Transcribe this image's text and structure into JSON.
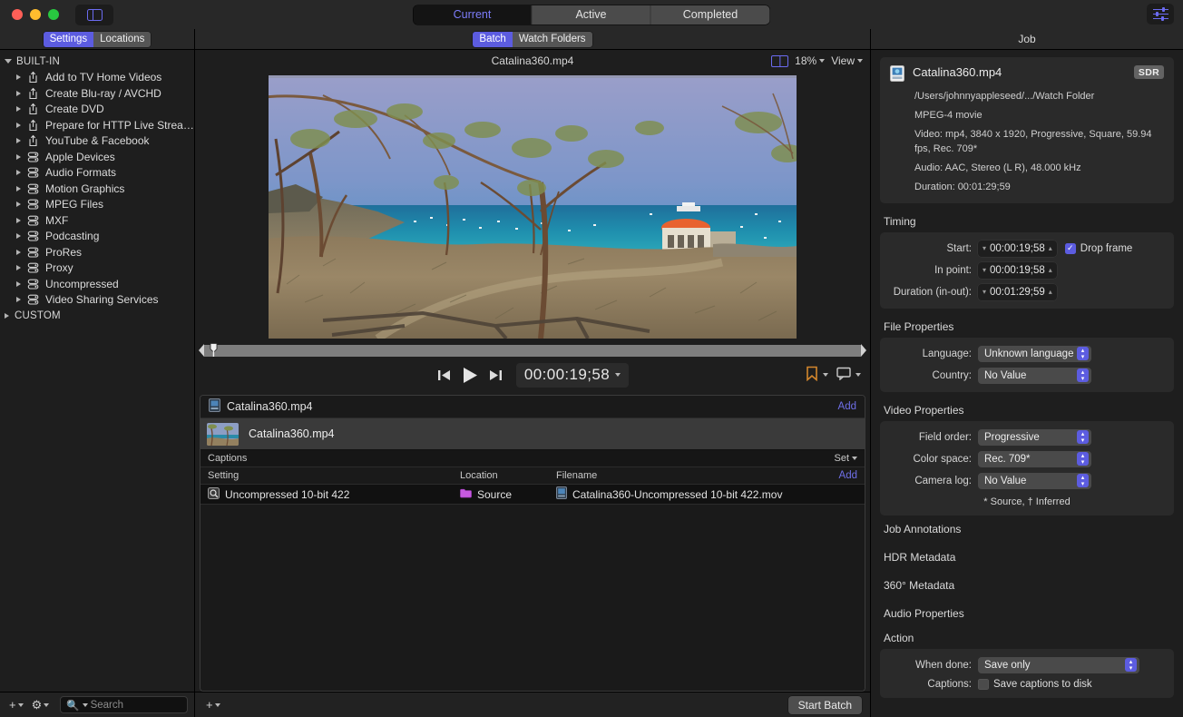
{
  "titlebar": {
    "sidebar_toggle_icon": "sidebar-icon",
    "segments": [
      {
        "label": "Current",
        "selected": true
      },
      {
        "label": "Active",
        "selected": false
      },
      {
        "label": "Completed",
        "selected": false
      }
    ],
    "inspector_toggle_icon": "sliders-icon"
  },
  "sidebar": {
    "tabs": [
      {
        "label": "Settings",
        "selected": true
      },
      {
        "label": "Locations",
        "selected": false
      }
    ],
    "groups": [
      {
        "label": "BUILT-IN",
        "expanded": true,
        "items": [
          {
            "label": "Add to TV Home Videos",
            "icon": "share-icon"
          },
          {
            "label": "Create Blu-ray / AVCHD",
            "icon": "share-icon"
          },
          {
            "label": "Create DVD",
            "icon": "share-icon"
          },
          {
            "label": "Prepare for HTTP Live Strea…",
            "icon": "share-icon"
          },
          {
            "label": "YouTube & Facebook",
            "icon": "share-icon"
          },
          {
            "label": "Apple Devices",
            "icon": "setting-icon"
          },
          {
            "label": "Audio Formats",
            "icon": "setting-icon"
          },
          {
            "label": "Motion Graphics",
            "icon": "setting-icon"
          },
          {
            "label": "MPEG Files",
            "icon": "setting-icon"
          },
          {
            "label": "MXF",
            "icon": "setting-icon"
          },
          {
            "label": "Podcasting",
            "icon": "setting-icon"
          },
          {
            "label": "ProRes",
            "icon": "setting-icon"
          },
          {
            "label": "Proxy",
            "icon": "setting-icon"
          },
          {
            "label": "Uncompressed",
            "icon": "setting-icon"
          },
          {
            "label": "Video Sharing Services",
            "icon": "setting-icon"
          }
        ]
      },
      {
        "label": "CUSTOM",
        "expanded": false,
        "items": []
      }
    ],
    "bottom": {
      "add_icon": "plus-icon",
      "gear_icon": "gear-icon",
      "search_placeholder": "Search"
    }
  },
  "center": {
    "tabs": [
      {
        "label": "Batch",
        "selected": true
      },
      {
        "label": "Watch Folders",
        "selected": false
      }
    ],
    "preview": {
      "title": "Catalina360.mp4",
      "split_icon": "split-view-icon",
      "zoom_level": "18%",
      "view_label": "View"
    },
    "transport": {
      "prev_icon": "skip-to-start-icon",
      "play_icon": "play-icon",
      "next_icon": "skip-to-end-icon",
      "timecode": "00:00:19;58",
      "marker_icon": "bookmark-icon",
      "caption_icon": "caption-icon"
    },
    "batch": {
      "job_name": "Catalina360.mp4",
      "add_label": "Add",
      "source_name": "Catalina360.mp4",
      "captions_label": "Captions",
      "captions_set_label": "Set",
      "columns": [
        "Setting",
        "Location",
        "Filename"
      ],
      "outputs_add_label": "Add",
      "rows": [
        {
          "setting": "Uncompressed 10-bit 422",
          "location": "Source",
          "filename": "Catalina360-Uncompressed 10-bit 422.mov"
        }
      ]
    },
    "bottom": {
      "add_icon": "plus-icon",
      "start_batch_label": "Start Batch"
    }
  },
  "inspector": {
    "title": "Job",
    "file": {
      "name": "Catalina360.mp4",
      "badge": "SDR",
      "path": "/Users/johnnyappleseed/.../Watch Folder",
      "kind": "MPEG-4 movie",
      "video": "Video: mp4, 3840 x 1920, Progressive, Square, 59.94 fps, Rec. 709*",
      "audio": "Audio: AAC, Stereo (L R), 48.000 kHz",
      "duration": "Duration: 00:01:29;59"
    },
    "timing": {
      "title": "Timing",
      "fields": [
        {
          "label": "Start:",
          "value": "00:00:19;58"
        },
        {
          "label": "In point:",
          "value": "00:00:19;58"
        },
        {
          "label": "Duration (in-out):",
          "value": "00:01:29;59"
        }
      ],
      "drop_frame_label": "Drop frame",
      "drop_frame_checked": true
    },
    "file_properties": {
      "title": "File Properties",
      "fields": [
        {
          "label": "Language:",
          "value": "Unknown language"
        },
        {
          "label": "Country:",
          "value": "No Value"
        }
      ]
    },
    "video_properties": {
      "title": "Video Properties",
      "fields": [
        {
          "label": "Field order:",
          "value": "Progressive"
        },
        {
          "label": "Color space:",
          "value": "Rec. 709*"
        },
        {
          "label": "Camera log:",
          "value": "No Value"
        }
      ],
      "note": "* Source, † Inferred"
    },
    "collapsed_sections": [
      "Job Annotations",
      "HDR Metadata",
      "360° Metadata",
      "Audio Properties"
    ],
    "action": {
      "title": "Action",
      "when_done_label": "When done:",
      "when_done_value": "Save only",
      "captions_label": "Captions:",
      "captions_checkbox_label": "Save captions to disk",
      "captions_checked": false
    }
  },
  "colors": {
    "accent": "#5c5ce0",
    "link": "#6f6fe8",
    "marker": "#d3862c",
    "window_bg": "#1e1e1e",
    "chrome": "#282828"
  }
}
